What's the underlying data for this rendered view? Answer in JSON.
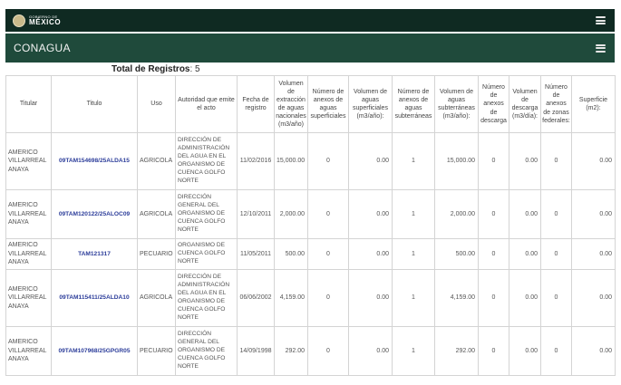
{
  "header": {
    "gov_small": "GOBIERNO DE",
    "gov_big": "MÉXICO",
    "menu_icon": "hamburger-icon"
  },
  "subheader": {
    "title": "CONAGUA",
    "menu_icon": "hamburger-icon"
  },
  "summary": {
    "label": "Total de Registros",
    "value": ": 5"
  },
  "table": {
    "columns": [
      "Titular",
      "Titulo",
      "Uso",
      "Autoridad que emite el acto",
      "Fecha de registro",
      "Volumen de extracción de aguas nacionales (m3/año)",
      "Número de anexos de aguas superficiales",
      "Volumen de aguas superficiales (m3/año):",
      "Número de anexos de aguas subterráneas",
      "Volumen de aguas subterráneas (m3/año):",
      "Número de anexos de descarga",
      "Volumen de descarga (m3/día):",
      "Número de anexos de zonas federales:",
      "Superficie (m2):"
    ],
    "rows": [
      {
        "titular": "AMERICO VILLARREAL ANAYA",
        "titulo": "09TAM154698/25ALDA15",
        "uso": "AGRICOLA",
        "autoridad": "DIRECCIÓN DE ADMINISTRACIÓN DEL AGUA EN EL ORGANISMO DE CUENCA GOLFO NORTE",
        "fecha": "11/02/2016",
        "vol_ext": "15,000.00",
        "n_sup": "0",
        "vol_sup": "0.00",
        "n_sub": "1",
        "vol_sub": "15,000.00",
        "n_desc": "0",
        "vol_desc": "0.00",
        "n_zonas": "0",
        "superficie": "0.00"
      },
      {
        "titular": "AMERICO VILLARREAL ANAYA",
        "titulo": "09TAM120122/25ALOC09",
        "uso": "AGRICOLA",
        "autoridad": "DIRECCIÓN GENERAL DEL ORGANISMO DE CUENCA GOLFO NORTE",
        "fecha": "12/10/2011",
        "vol_ext": "2,000.00",
        "n_sup": "0",
        "vol_sup": "0.00",
        "n_sub": "1",
        "vol_sub": "2,000.00",
        "n_desc": "0",
        "vol_desc": "0.00",
        "n_zonas": "0",
        "superficie": "0.00"
      },
      {
        "titular": "AMERICO VILLARREAL ANAYA",
        "titulo": "TAM121317",
        "uso": "PECUARIO",
        "autoridad": "ORGANISMO DE CUENCA GOLFO NORTE",
        "fecha": "11/05/2011",
        "vol_ext": "500.00",
        "n_sup": "0",
        "vol_sup": "0.00",
        "n_sub": "1",
        "vol_sub": "500.00",
        "n_desc": "0",
        "vol_desc": "0.00",
        "n_zonas": "0",
        "superficie": "0.00"
      },
      {
        "titular": "AMERICO VILLARREAL ANAYA",
        "titulo": "09TAM115411/25ALDA10",
        "uso": "AGRICOLA",
        "autoridad": "DIRECCIÓN DE ADMINISTRACIÓN DEL AGUA EN EL ORGANISMO DE CUENCA GOLFO NORTE",
        "fecha": "06/06/2002",
        "vol_ext": "4,159.00",
        "n_sup": "0",
        "vol_sup": "0.00",
        "n_sub": "1",
        "vol_sub": "4,159.00",
        "n_desc": "0",
        "vol_desc": "0.00",
        "n_zonas": "0",
        "superficie": "0.00"
      },
      {
        "titular": "AMERICO VILLARREAL ANAYA",
        "titulo": "09TAM107968/25GPGR05",
        "uso": "PECUARIO",
        "autoridad": "DIRECCIÓN GENERAL DEL ORGANISMO DE CUENCA GOLFO NORTE",
        "fecha": "14/09/1998",
        "vol_ext": "292.00",
        "n_sup": "0",
        "vol_sup": "0.00",
        "n_sub": "1",
        "vol_sub": "292.00",
        "n_desc": "0",
        "vol_desc": "0.00",
        "n_zonas": "0",
        "superficie": "0.00"
      }
    ]
  },
  "colors": {
    "topbar": "#0f2a22",
    "subbar": "#1f4a3b",
    "link": "#2c3d9a"
  }
}
